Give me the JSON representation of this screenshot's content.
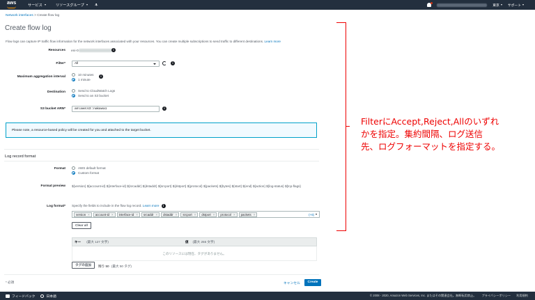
{
  "topbar": {
    "logo": "aws",
    "services": "サービス",
    "resource_groups": "リソースグループ",
    "region": "東京",
    "support": "サポート"
  },
  "breadcrumb": {
    "parent": "Network interfaces",
    "sep": ">",
    "current": "Create flow log"
  },
  "page": {
    "title": "Create flow log",
    "description": "Flow logs can capture IP traffic flow information for the network interfaces associated with your resources. You can create multiple subscriptions to send traffic to different destinations.",
    "learn_more": "Learn more"
  },
  "form": {
    "resources_label": "Resources",
    "resources_value": "eni-0",
    "filter_label": "Filter*",
    "filter_value": "All",
    "interval_label": "Maximum aggregation interval",
    "interval_options": [
      "10 minutes",
      "1 minute"
    ],
    "destination_label": "Destination",
    "destination_options": [
      "Send to CloudWatch Logs",
      "Send to an S3 bucket"
    ],
    "s3_label": "S3 bucket ARN*",
    "s3_value": "arn:aws:s3:::nakawa1"
  },
  "notice": "Please note, a resource-based policy will be created for you and attached to the target bucket.",
  "log_format": {
    "section_title": "Log record format",
    "format_label": "Format",
    "format_options": [
      "AWS default format",
      "Custom format"
    ],
    "preview_label": "Format preview",
    "preview_text": "${version} ${account-id} ${interface-id} ${srcaddr} ${dstaddr} ${srcport} ${dstport} ${protocol} ${packets} ${bytes} ${start} ${end} ${action} ${log-status} ${tcp-flags}",
    "log_format_label": "Log format*",
    "log_format_help": "Specify the fields to include in the flow log record.",
    "learn_more": "Learn more",
    "tokens": [
      "version",
      "account-id",
      "interface-id",
      "srcaddr",
      "dstaddr",
      "srcport",
      "dstport",
      "protocol",
      "packets"
    ],
    "more": "(+6)",
    "clear_all": "Clear all"
  },
  "tags": {
    "key_header": "キー",
    "key_limit": "(最大 127 文字)",
    "value_header": "値",
    "value_limit": "(最大 255 文字)",
    "empty": "このリソースには現在、タグがありません。",
    "add_button": "タグの追加",
    "remaining": "残り 50",
    "max": "(最大 50 タグ)"
  },
  "footer": {
    "required_note": "* 必須",
    "cancel": "キャンセル",
    "create": "Create"
  },
  "annotation": {
    "line1": "FilterにAccept,Reject,Allのいずれ",
    "line2": "かを指定。集約間隔、ログ送信",
    "line3": "先、ログフォーマットを指定する。"
  },
  "bottombar": {
    "feedback": "フィードバック",
    "language": "日本語",
    "copyright": "© 2008 - 2020, Amazon Web Services, Inc. またはその関連会社。無断転用禁止。",
    "privacy": "プライバシーポリシー",
    "terms": "利用規約"
  },
  "colors": {
    "accent": "#0073bb",
    "topbar": "#232f3e",
    "annotation": "#ee0000",
    "brand": "#ff9900"
  }
}
